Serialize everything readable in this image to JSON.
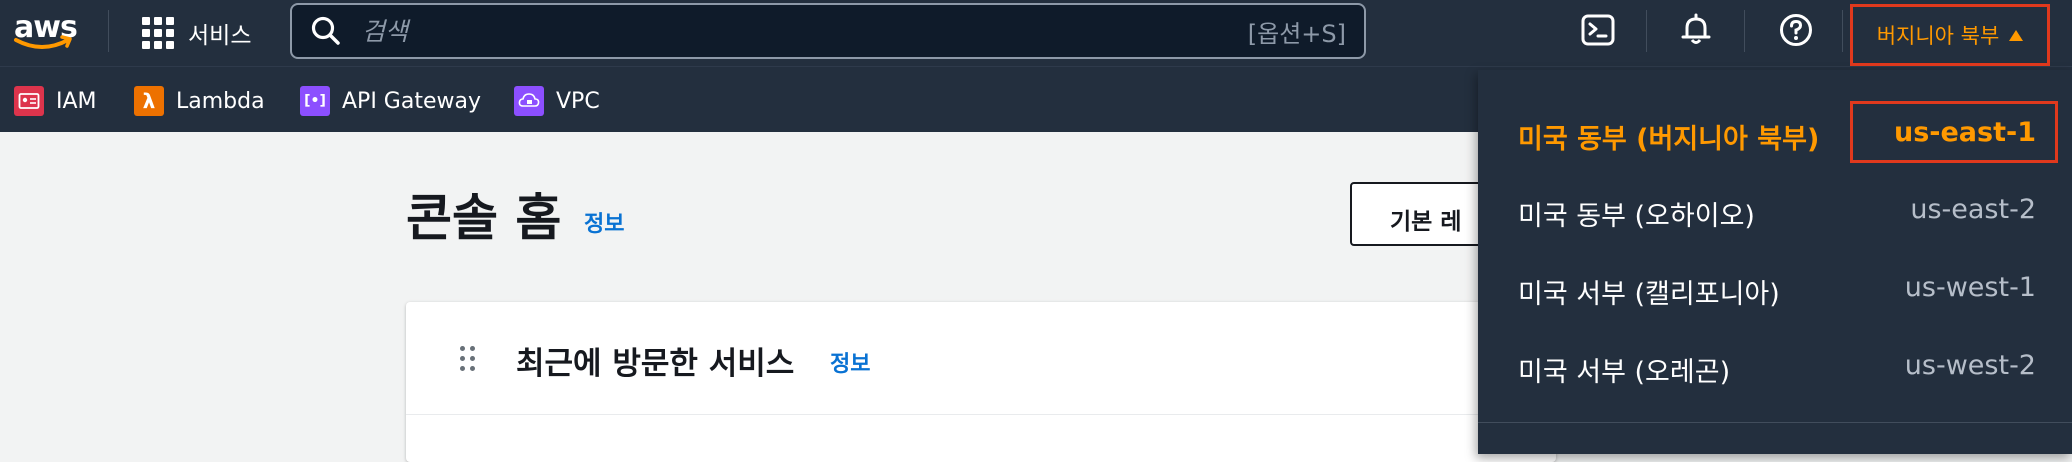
{
  "nav": {
    "logo": "aws",
    "services_label": "서비스",
    "search_placeholder": "검색",
    "search_shortcut": "[옵션+S]",
    "region_button": "버지니아 북부"
  },
  "favorites": [
    {
      "label": "IAM",
      "color": "#dd344c",
      "icon": "iam-icon"
    },
    {
      "label": "Lambda",
      "color": "#ed7100",
      "icon": "lambda-icon"
    },
    {
      "label": "API Gateway",
      "color": "#8c4fff",
      "icon": "api-gateway-icon"
    },
    {
      "label": "VPC",
      "color": "#8c4fff",
      "icon": "vpc-icon"
    }
  ],
  "main": {
    "title": "콘솔 홈",
    "title_info": "정보",
    "layout_button": "기본 레",
    "card_title": "최근에 방문한 서비스",
    "card_info": "정보"
  },
  "regions": [
    {
      "name": "미국 동부 (버지니아 북부)",
      "code": "us-east-1",
      "selected": true
    },
    {
      "name": "미국 동부 (오하이오)",
      "code": "us-east-2",
      "selected": false
    },
    {
      "name": "미국 서부 (캘리포니아)",
      "code": "us-west-1",
      "selected": false
    },
    {
      "name": "미국 서부 (오레곤)",
      "code": "us-west-2",
      "selected": false
    }
  ],
  "colors": {
    "nav_bg": "#232f3e",
    "accent": "#ff9900",
    "highlight_border": "#e0391d",
    "link": "#0972d3"
  }
}
